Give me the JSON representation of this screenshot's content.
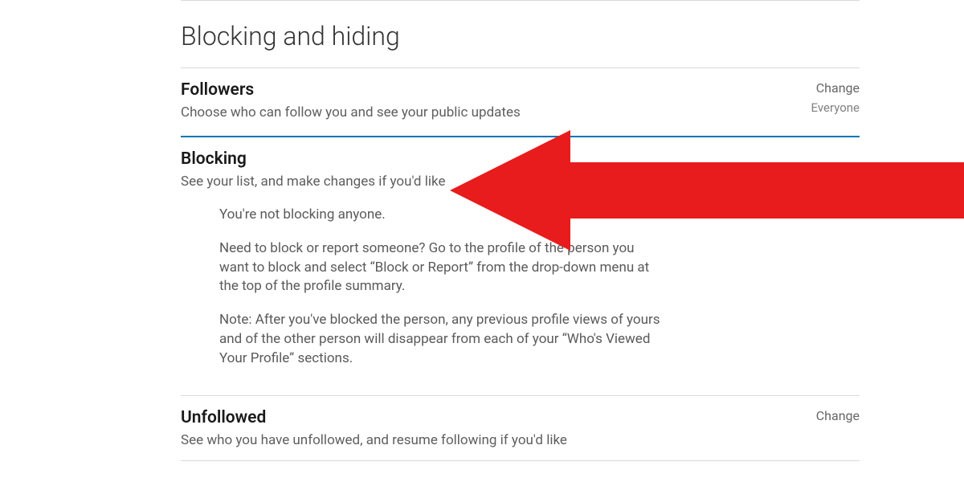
{
  "page": {
    "title": "Blocking and hiding"
  },
  "sections": {
    "followers": {
      "title": "Followers",
      "subtitle": "Choose who can follow you and see your public updates",
      "action": "Change",
      "value": "Everyone"
    },
    "blocking": {
      "title": "Blocking",
      "subtitle": "See your list, and make changes if you'd like",
      "content": {
        "empty": "You're not blocking anyone.",
        "instructions": "Need to block or report someone? Go to the profile of the person you want to block and select “Block or Report” from the drop-down menu at the top of the profile summary.",
        "note": "Note: After you've blocked the person, any previous profile views of yours and of the other person will disappear from each of your “Who's Viewed Your Profile” sections."
      }
    },
    "unfollowed": {
      "title": "Unfollowed",
      "subtitle": "See who you have unfollowed, and resume following if you'd like",
      "action": "Change"
    }
  }
}
